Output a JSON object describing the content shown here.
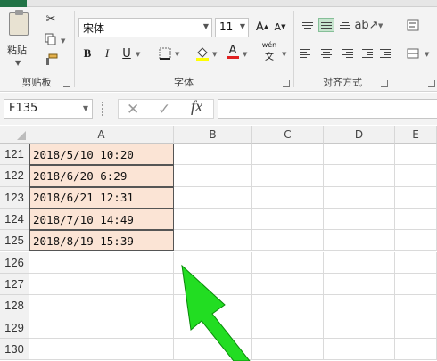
{
  "ribbon": {
    "clipboard": {
      "paste_label": "粘贴",
      "group_label": "剪贴板"
    },
    "font": {
      "font_name": "宋体",
      "font_size": "11",
      "bold": "B",
      "italic": "I",
      "underline": "U",
      "phonetic": "wén",
      "group_label": "字体"
    },
    "alignment": {
      "group_label": "对齐方式"
    }
  },
  "formula_bar": {
    "name_box": "F135",
    "fx": "fx",
    "formula": ""
  },
  "grid": {
    "columns": [
      "A",
      "B",
      "C",
      "D",
      "E"
    ],
    "rows": [
      {
        "num": "121",
        "a": "2018/5/10 10:20"
      },
      {
        "num": "122",
        "a": "2018/6/20 6:29"
      },
      {
        "num": "123",
        "a": "2018/6/21 12:31"
      },
      {
        "num": "124",
        "a": "2018/7/10 14:49"
      },
      {
        "num": "125",
        "a": "2018/8/19 15:39"
      },
      {
        "num": "126",
        "a": ""
      },
      {
        "num": "127",
        "a": ""
      },
      {
        "num": "128",
        "a": ""
      },
      {
        "num": "129",
        "a": ""
      },
      {
        "num": "130",
        "a": ""
      }
    ]
  },
  "colors": {
    "accent_green": "#217346",
    "cell_fill": "#fbe4d5",
    "arrow_green": "#22dd22"
  }
}
